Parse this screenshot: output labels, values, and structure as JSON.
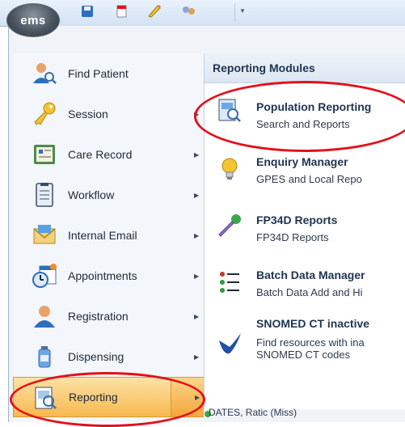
{
  "app": {
    "orb_label": "ems"
  },
  "quick_access": [
    {
      "icon": "save-icon"
    },
    {
      "icon": "new-document-icon"
    },
    {
      "icon": "edit-icon"
    },
    {
      "icon": "users-icon"
    }
  ],
  "left_menu": {
    "items": [
      {
        "label": "Find Patient",
        "icon": "find-patient-icon",
        "has_submenu": false
      },
      {
        "label": "Session",
        "icon": "key-icon",
        "has_submenu": true
      },
      {
        "label": "Care Record",
        "icon": "care-record-icon",
        "has_submenu": true
      },
      {
        "label": "Workflow",
        "icon": "workflow-icon",
        "has_submenu": true
      },
      {
        "label": "Internal Email",
        "icon": "email-icon",
        "has_submenu": true
      },
      {
        "label": "Appointments",
        "icon": "calendar-clock-icon",
        "has_submenu": true
      },
      {
        "label": "Registration",
        "icon": "registration-icon",
        "has_submenu": true
      },
      {
        "label": "Dispensing",
        "icon": "bottle-icon",
        "has_submenu": true
      },
      {
        "label": "Reporting",
        "icon": "reporting-icon",
        "has_submenu": true,
        "active": true
      }
    ]
  },
  "right_panel": {
    "header": "Reporting Modules",
    "items": [
      {
        "title": "Population Reporting",
        "subtitle": "Search and Reports",
        "icon": "population-reporting-icon"
      },
      {
        "title": "Enquiry Manager",
        "subtitle": "GPES and Local Repo",
        "icon": "lightbulb-icon"
      },
      {
        "title": "FP34D Reports",
        "subtitle": "FP34D Reports",
        "icon": "dropper-icon"
      },
      {
        "title": "Batch Data Manager",
        "subtitle": "Batch Data Add and Hi",
        "icon": "batch-data-icon"
      },
      {
        "title": "SNOMED CT inactive",
        "subtitle": "Find resources with ina",
        "subtitle2": "SNOMED CT codes",
        "icon": "snomed-icon"
      }
    ],
    "bottom_text": "DATES, Ratic (Miss)"
  },
  "colors": {
    "highlight": "#f7b84f",
    "annotation_red": "#e3101a",
    "frame_border": "#9fb4cf"
  }
}
